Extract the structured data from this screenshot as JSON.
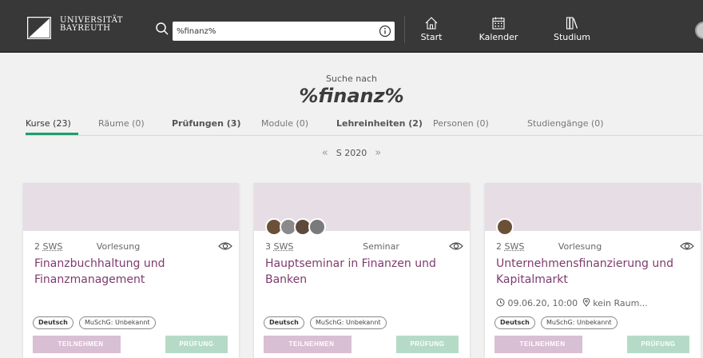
{
  "header": {
    "logo_line1": "UNIVERSITÄT",
    "logo_line2": "BAYREUTH",
    "search_value": "%finanz%",
    "nav": [
      {
        "label": "Start",
        "icon": "home-icon"
      },
      {
        "label": "Kalender",
        "icon": "calendar-icon"
      },
      {
        "label": "Studium",
        "icon": "books-icon"
      }
    ]
  },
  "heading": {
    "prefix": "Suche nach",
    "query": "%finanz%"
  },
  "tabs": [
    {
      "label": "Kurse (23)",
      "active": true
    },
    {
      "label": "Räume (0)"
    },
    {
      "label": "Prüfungen (3)"
    },
    {
      "label": "Module (0)"
    },
    {
      "label": "Lehreinheiten (2)"
    },
    {
      "label": "Personen (0)"
    },
    {
      "label": "Studiengänge (0)"
    }
  ],
  "semester": {
    "prev": "«",
    "label": "S 2020",
    "next": "»"
  },
  "cards": [
    {
      "sws_num": "2",
      "sws_unit": "SWS",
      "type": "Vorlesung",
      "title": "Finanzbuchhaltung und Finanzmanagement",
      "date": "",
      "tag_language": "Deutsch",
      "tag_muschg": "MuSchG: Unbekannt",
      "btn_join": "TEILNEHMEN",
      "btn_exam": "PRÜFUNG"
    },
    {
      "sws_num": "3",
      "sws_unit": "SWS",
      "type": "Seminar",
      "title": "Hauptseminar in Finanzen und Banken",
      "date": "",
      "tag_language": "Deutsch",
      "tag_muschg": "MuSchG: Unbekannt",
      "btn_join": "TEILNEHMEN",
      "btn_exam": "PRÜFUNG"
    },
    {
      "sws_num": "2",
      "sws_unit": "SWS",
      "type": "Vorlesung",
      "title": "Unternehmensfinanzierung und Kapitalmarkt",
      "date": "09.06.20, 10:00",
      "room": "kein Raum...",
      "tag_language": "Deutsch",
      "tag_muschg": "MuSchG: Unbekannt",
      "btn_join": "TEILNEHMEN",
      "btn_exam": "PRÜFUNG"
    }
  ],
  "colors": {
    "topbar": "#383838",
    "accent_green": "#1f9e6d",
    "title_purple": "#7d3b6d",
    "card_head": "#e7dde5",
    "btn_join": "#d9bfd3",
    "btn_exam": "#b5dbc6"
  }
}
